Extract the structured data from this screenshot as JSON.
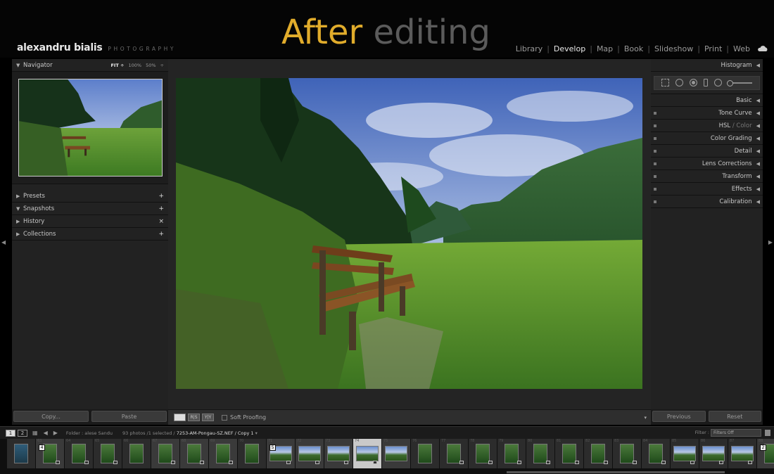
{
  "header": {
    "brand_name": "alexandru bialis",
    "brand_sub": "PHOTOGRAPHY",
    "headline_word1": "After",
    "headline_word2": "editing",
    "modules": [
      "Library",
      "Develop",
      "Map",
      "Book",
      "Slideshow",
      "Print",
      "Web"
    ],
    "active_module": "Develop",
    "cloud_icon": "cloud-icon"
  },
  "left_panel": {
    "navigator": {
      "title": "Navigator",
      "zoom_fit": "FIT ÷",
      "zoom_100": "100%",
      "zoom_50": "50%",
      "zoom_more": "÷"
    },
    "sections": [
      {
        "label": "Presets",
        "action": "+"
      },
      {
        "label": "Snapshots",
        "action": "+"
      },
      {
        "label": "History",
        "action": "×"
      },
      {
        "label": "Collections",
        "action": "+"
      }
    ],
    "copy_label": "Copy...",
    "paste_label": "Paste"
  },
  "toolbar": {
    "view_box": "",
    "view_compare": "R|S",
    "view_split": "Y|Y",
    "soft_proofing": "Soft Proofing",
    "menu": "▾"
  },
  "right_panel": {
    "histogram": "Histogram",
    "sections": [
      {
        "label": "Basic"
      },
      {
        "label": "Tone Curve"
      },
      {
        "label": "HSL",
        "dim": " / Color"
      },
      {
        "label": "Color Grading"
      },
      {
        "label": "Detail"
      },
      {
        "label": "Lens Corrections"
      },
      {
        "label": "Transform"
      },
      {
        "label": "Effects"
      },
      {
        "label": "Calibration"
      }
    ],
    "previous_label": "Previous",
    "reset_label": "Reset"
  },
  "filmstrip_bar": {
    "view1": "1",
    "view2": "2",
    "folder": "Folder : alese Sandu",
    "count": "93 photos /1 selected /",
    "selected_file": "7253-AM-Pongau-SZ.NEF / Copy 1",
    "filter_label": "Filter :",
    "filter_value": "Filters Off"
  },
  "filmstrip": {
    "stack_badges": [
      "4",
      "5",
      "2"
    ],
    "cell_numbers": [
      "63",
      "64",
      "65",
      "66",
      "67",
      "68",
      "69",
      "70",
      "71",
      "72",
      "73",
      "74",
      "75",
      "76",
      "77",
      "78",
      "79",
      "80",
      "81",
      "82",
      "83",
      "84",
      "85",
      "86",
      "87",
      "88"
    ]
  }
}
